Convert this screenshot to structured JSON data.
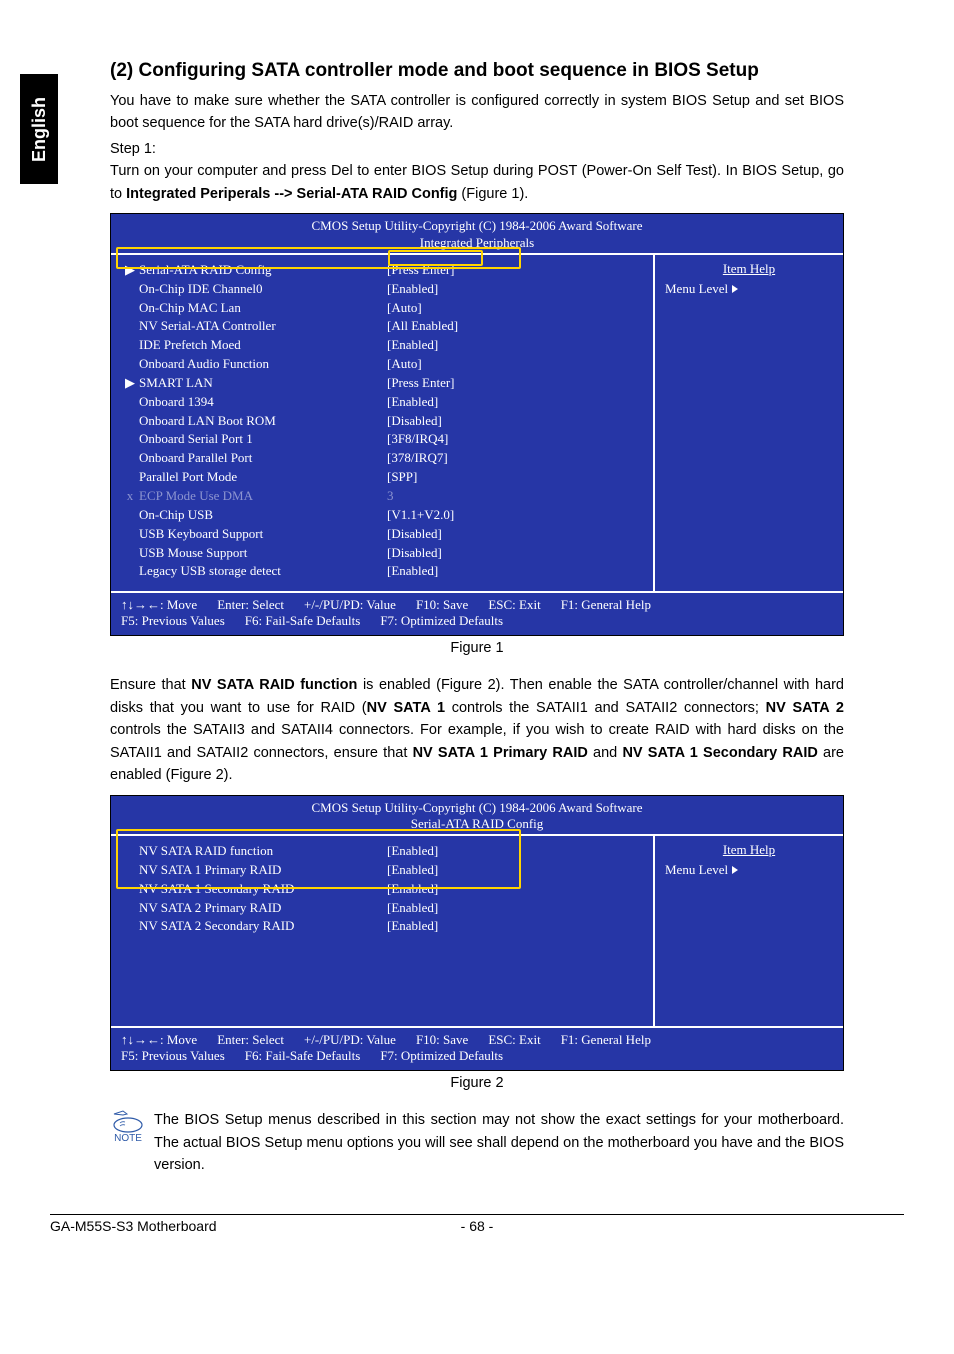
{
  "sideTab": "English",
  "heading": "(2) Configuring SATA controller mode and boot sequence in BIOS Setup",
  "para1_a": "You have to make sure whether the SATA controller is configured correctly in system BIOS Setup and set BIOS boot sequence for the SATA hard drive(s)/RAID array.",
  "step1": "Step 1:",
  "para1_b_pre": "Turn on your computer and press Del to enter BIOS Setup during POST (Power-On Self Test). In BIOS Setup, go to ",
  "para1_b_bold": "Integrated Periperals --> Serial-ATA RAID Config",
  "para1_b_post": " (Figure 1).",
  "bios_header": "CMOS Setup Utility-Copyright (C) 1984-2006 Award Software",
  "fig1": {
    "subtitle": "Integrated Peripherals",
    "rows": [
      {
        "m": "▶",
        "label": "Serial-ATA RAID Config",
        "val": "[Press Enter]",
        "dim": false
      },
      {
        "m": "",
        "label": "On-Chip IDE Channel0",
        "val": "[Enabled]",
        "dim": false
      },
      {
        "m": "",
        "label": "On-Chip MAC Lan",
        "val": "[Auto]",
        "dim": false
      },
      {
        "m": "",
        "label": "NV Serial-ATA Controller",
        "val": "[All Enabled]",
        "dim": false
      },
      {
        "m": "",
        "label": "IDE Prefetch Moed",
        "val": "[Enabled]",
        "dim": false
      },
      {
        "m": "",
        "label": "Onboard Audio Function",
        "val": "[Auto]",
        "dim": false
      },
      {
        "m": "▶",
        "label": "SMART LAN",
        "val": "[Press Enter]",
        "dim": false
      },
      {
        "m": "",
        "label": "Onboard 1394",
        "val": "[Enabled]",
        "dim": false
      },
      {
        "m": "",
        "label": "Onboard LAN Boot ROM",
        "val": "[Disabled]",
        "dim": false
      },
      {
        "m": "",
        "label": "Onboard Serial Port 1",
        "val": "[3F8/IRQ4]",
        "dim": false
      },
      {
        "m": "",
        "label": "Onboard Parallel Port",
        "val": "[378/IRQ7]",
        "dim": false
      },
      {
        "m": "",
        "label": "Parallel Port Mode",
        "val": "[SPP]",
        "dim": false
      },
      {
        "m": "x",
        "label": "ECP Mode Use DMA",
        "val": "3",
        "dim": true
      },
      {
        "m": "",
        "label": "On-Chip USB",
        "val": "[V1.1+V2.0]",
        "dim": false
      },
      {
        "m": "",
        "label": "USB Keyboard Support",
        "val": "[Disabled]",
        "dim": false
      },
      {
        "m": "",
        "label": "USB Mouse Support",
        "val": "[Disabled]",
        "dim": false
      },
      {
        "m": "",
        "label": "Legacy USB storage detect",
        "val": "[Enabled]",
        "dim": false
      }
    ],
    "side_title": "Item Help",
    "side_sub": "Menu Level",
    "footer": [
      "↑↓→←: Move",
      "Enter: Select",
      "+/-/PU/PD: Value",
      "F10: Save",
      "ESC: Exit",
      "F1: General Help",
      "F5: Previous Values",
      "F6: Fail-Safe Defaults",
      "F7: Optimized Defaults"
    ],
    "caption": "Figure 1"
  },
  "para2_a": "Ensure that ",
  "para2_b1": "NV SATA RAID function",
  "para2_c": " is enabled (Figure 2). Then enable the SATA controller/channel with hard disks that you want to use for RAID (",
  "para2_b2": "NV SATA 1",
  "para2_d": " controls the SATAII1 and SATAII2 connectors; ",
  "para2_b3": "NV SATA 2",
  "para2_e": " controls the SATAII3 and SATAII4 connectors. For example, if you wish to create RAID with hard disks on the SATAII1 and SATAII2 connectors, ensure that ",
  "para2_b4": "NV SATA 1 Primary RAID",
  "para2_f": " and ",
  "para2_b5": "NV SATA 1 Secondary RAID",
  "para2_g": " are enabled (Figure 2).",
  "fig2": {
    "subtitle": "Serial-ATA RAID Config",
    "rows": [
      {
        "m": "",
        "label": "NV SATA RAID function",
        "val": "[Enabled]",
        "dim": false
      },
      {
        "m": "",
        "label": "NV SATA 1 Primary RAID",
        "val": "[Enabled]",
        "dim": false
      },
      {
        "m": "",
        "label": "NV SATA 1 Secondary RAID",
        "val": "[Enabled]",
        "dim": false
      },
      {
        "m": "",
        "label": "NV SATA 2 Primary RAID",
        "val": "[Enabled]",
        "dim": false
      },
      {
        "m": "",
        "label": "NV SATA 2 Secondary RAID",
        "val": "[Enabled]",
        "dim": false
      }
    ],
    "side_title": "Item Help",
    "side_sub": "Menu Level",
    "caption": "Figure 2"
  },
  "note": "The BIOS Setup menus described in this section may not show the exact settings for your motherboard. The actual BIOS Setup menu options you will see shall depend on the motherboard you have and the BIOS version.",
  "note_label": "NOTE",
  "footer_left": "GA-M55S-S3 Motherboard",
  "footer_page": "- 68 -"
}
